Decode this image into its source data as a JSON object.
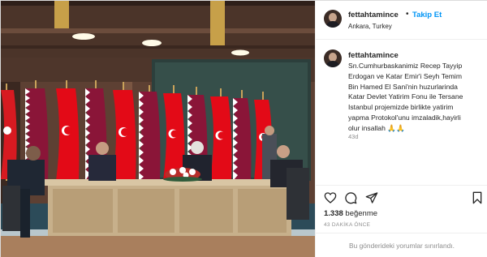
{
  "post": {
    "username": "fettahtamince",
    "follow_label": "Takip Et",
    "separator": "•",
    "location": "Ankara, Turkey",
    "caption": "Sn.Cumhurbaskanimiz Recep Tayyip\nErdogan ve Katar Emir'i Seyh Temim\nBin Hamed El Sani'nin huzurlarinda\nKatar Devlet Yatirim Fonu ile Tersane\nIstanbul projemizde birlikte yatirim\nyapma Protokol'unu imzaladik,hayirli\nolur insallah 🙏🙏",
    "caption_age": "43d",
    "likes_count": "1.338",
    "likes_word": "beğenme",
    "timestamp": "43 DAKİKA ÖNCE",
    "comments_disabled_text": "Bu gönderideki yorumlar sınırlandı."
  },
  "icons": {
    "like": "heart-icon",
    "comment": "comment-icon",
    "share": "share-icon",
    "save": "bookmark-icon"
  },
  "colors": {
    "accent": "#0095f6",
    "secondary_text": "#8e8e8e",
    "flag_turkey": "#e30a17",
    "flag_qatar": "#8a1538"
  }
}
